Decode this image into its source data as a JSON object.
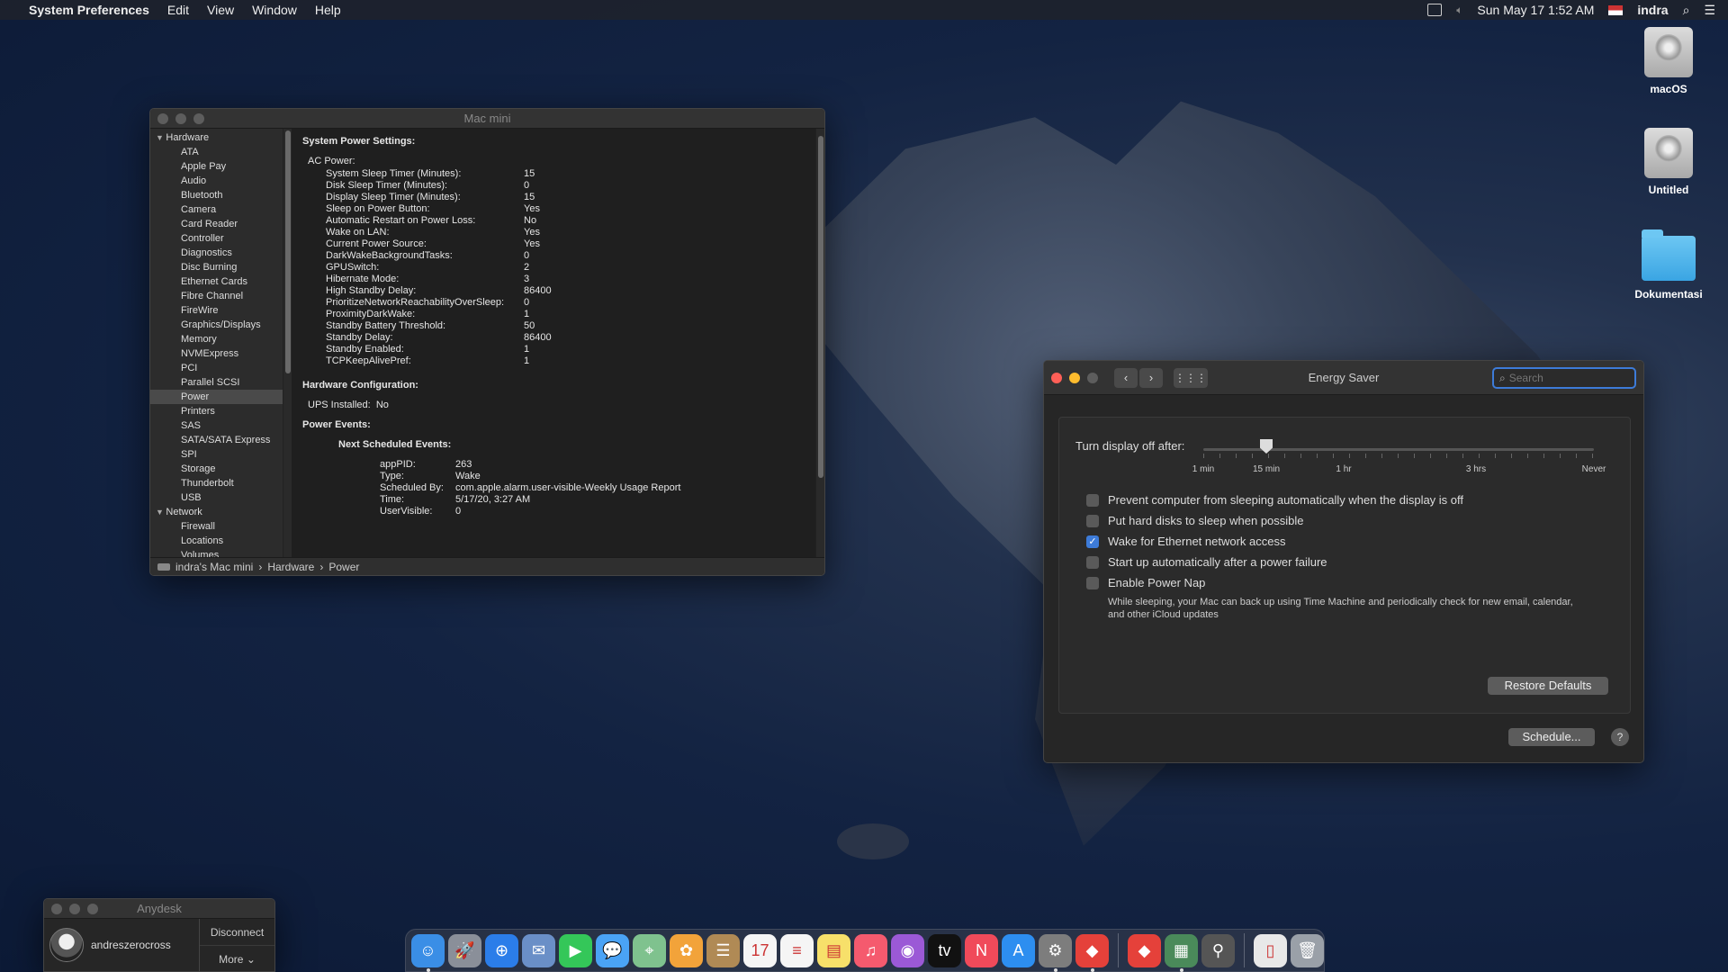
{
  "menubar": {
    "app_name": "System Preferences",
    "menus": [
      "Edit",
      "View",
      "Window",
      "Help"
    ],
    "datetime": "Sun May 17  1:52 AM",
    "user": "indra"
  },
  "desktop_icons": [
    {
      "label": "macOS"
    },
    {
      "label": "Untitled"
    },
    {
      "label": "Dokumentasi"
    }
  ],
  "sysinfo": {
    "title": "Mac mini",
    "sidebar": {
      "hardware_label": "Hardware",
      "hardware_items": [
        "ATA",
        "Apple Pay",
        "Audio",
        "Bluetooth",
        "Camera",
        "Card Reader",
        "Controller",
        "Diagnostics",
        "Disc Burning",
        "Ethernet Cards",
        "Fibre Channel",
        "FireWire",
        "Graphics/Displays",
        "Memory",
        "NVMExpress",
        "PCI",
        "Parallel SCSI",
        "Power",
        "Printers",
        "SAS",
        "SATA/SATA Express",
        "SPI",
        "Storage",
        "Thunderbolt",
        "USB"
      ],
      "network_label": "Network",
      "network_items": [
        "Firewall",
        "Locations",
        "Volumes"
      ],
      "selected": "Power"
    },
    "content": {
      "heading1": "System Power Settings:",
      "ac_power": "AC Power:",
      "settings": [
        [
          "System Sleep Timer (Minutes):",
          "15"
        ],
        [
          "Disk Sleep Timer (Minutes):",
          "0"
        ],
        [
          "Display Sleep Timer (Minutes):",
          "15"
        ],
        [
          "Sleep on Power Button:",
          "Yes"
        ],
        [
          "Automatic Restart on Power Loss:",
          "No"
        ],
        [
          "Wake on LAN:",
          "Yes"
        ],
        [
          "Current Power Source:",
          "Yes"
        ],
        [
          "DarkWakeBackgroundTasks:",
          "0"
        ],
        [
          "GPUSwitch:",
          "2"
        ],
        [
          "Hibernate Mode:",
          "3"
        ],
        [
          "High Standby Delay:",
          "86400"
        ],
        [
          "PrioritizeNetworkReachabilityOverSleep:",
          "0"
        ],
        [
          "ProximityDarkWake:",
          "1"
        ],
        [
          "Standby Battery Threshold:",
          "50"
        ],
        [
          "Standby Delay:",
          "86400"
        ],
        [
          "Standby Enabled:",
          "1"
        ],
        [
          "TCPKeepAlivePref:",
          "1"
        ]
      ],
      "heading2": "Hardware Configuration:",
      "ups_label": "UPS Installed:",
      "ups_value": "No",
      "heading3": "Power Events:",
      "next_events": "Next Scheduled Events:",
      "event": [
        [
          "appPID:",
          "263"
        ],
        [
          "Type:",
          "Wake"
        ],
        [
          "Scheduled By:",
          "com.apple.alarm.user-visible-Weekly Usage Report"
        ],
        [
          "Time:",
          "5/17/20, 3:27 AM"
        ],
        [
          "UserVisible:",
          "0"
        ]
      ]
    },
    "pathbar": [
      "indra's Mac mini",
      "Hardware",
      "Power"
    ]
  },
  "energy": {
    "title": "Energy Saver",
    "search_placeholder": "Search",
    "slider_label": "Turn display off after:",
    "slider_ticks": [
      "1 min",
      "15 min",
      "1 hr",
      "3 hrs",
      "Never"
    ],
    "slider_value": "15 min",
    "options": [
      {
        "label": "Prevent computer from sleeping automatically when the display is off",
        "checked": false
      },
      {
        "label": "Put hard disks to sleep when possible",
        "checked": false
      },
      {
        "label": "Wake for Ethernet network access",
        "checked": true
      },
      {
        "label": "Start up automatically after a power failure",
        "checked": false
      },
      {
        "label": "Enable Power Nap",
        "checked": false
      }
    ],
    "power_nap_note": "While sleeping, your Mac can back up using Time Machine and periodically check for new email, calendar, and other iCloud updates",
    "restore_label": "Restore Defaults",
    "schedule_label": "Schedule...",
    "help_label": "?"
  },
  "anydesk": {
    "title": "Anydesk",
    "username": "andreszerocross",
    "disconnect_label": "Disconnect",
    "more_label": "More"
  },
  "dock": {
    "apps": [
      {
        "name": "finder-icon",
        "color": "#3a8ee6",
        "glyph": "☺",
        "running": true
      },
      {
        "name": "launchpad-icon",
        "color": "#8a8f99",
        "glyph": "🚀",
        "running": false
      },
      {
        "name": "safari-icon",
        "color": "#2b7de9",
        "glyph": "⊕",
        "running": false
      },
      {
        "name": "mail-icon",
        "color": "#6a8fc7",
        "glyph": "✉",
        "running": false
      },
      {
        "name": "facetime-icon",
        "color": "#34c759",
        "glyph": "▶",
        "running": false
      },
      {
        "name": "messages-icon",
        "color": "#4aa3f5",
        "glyph": "💬",
        "running": false
      },
      {
        "name": "maps-icon",
        "color": "#7fc28e",
        "glyph": "⌖",
        "running": false
      },
      {
        "name": "photos-icon",
        "color": "#f2a33a",
        "glyph": "✿",
        "running": false
      },
      {
        "name": "contacts-icon",
        "color": "#b08a55",
        "glyph": "☰",
        "running": false
      },
      {
        "name": "calendar-icon",
        "color": "#f5f5f5",
        "glyph": "17",
        "running": false
      },
      {
        "name": "reminders-icon",
        "color": "#f5f5f5",
        "glyph": "≡",
        "running": false
      },
      {
        "name": "notes-icon",
        "color": "#f7e06a",
        "glyph": "▤",
        "running": false
      },
      {
        "name": "music-icon",
        "color": "#f55a6e",
        "glyph": "♫",
        "running": false
      },
      {
        "name": "podcasts-icon",
        "color": "#9b59d6",
        "glyph": "◉",
        "running": false
      },
      {
        "name": "tv-icon",
        "color": "#111111",
        "glyph": "tv",
        "running": false
      },
      {
        "name": "news-icon",
        "color": "#f04a5a",
        "glyph": "N",
        "running": false
      },
      {
        "name": "app-store-icon",
        "color": "#2d8ef0",
        "glyph": "A",
        "running": false
      },
      {
        "name": "system-preferences-icon",
        "color": "#7d7d7d",
        "glyph": "⚙",
        "running": true
      },
      {
        "name": "anydesk-icon",
        "color": "#e5413a",
        "glyph": "◆",
        "running": true
      },
      {
        "name": "anydesk-alt-icon",
        "color": "#e5413a",
        "glyph": "◆",
        "running": false
      },
      {
        "name": "system-information-icon",
        "color": "#4a8a5a",
        "glyph": "▦",
        "running": true
      },
      {
        "name": "utility-icon",
        "color": "#555555",
        "glyph": "⚲",
        "running": false
      }
    ],
    "trailing": [
      {
        "name": "document-icon",
        "color": "#e8e8e8",
        "glyph": "▯"
      },
      {
        "name": "trash-icon",
        "color": "#9aa0a8",
        "glyph": "🗑"
      }
    ]
  }
}
